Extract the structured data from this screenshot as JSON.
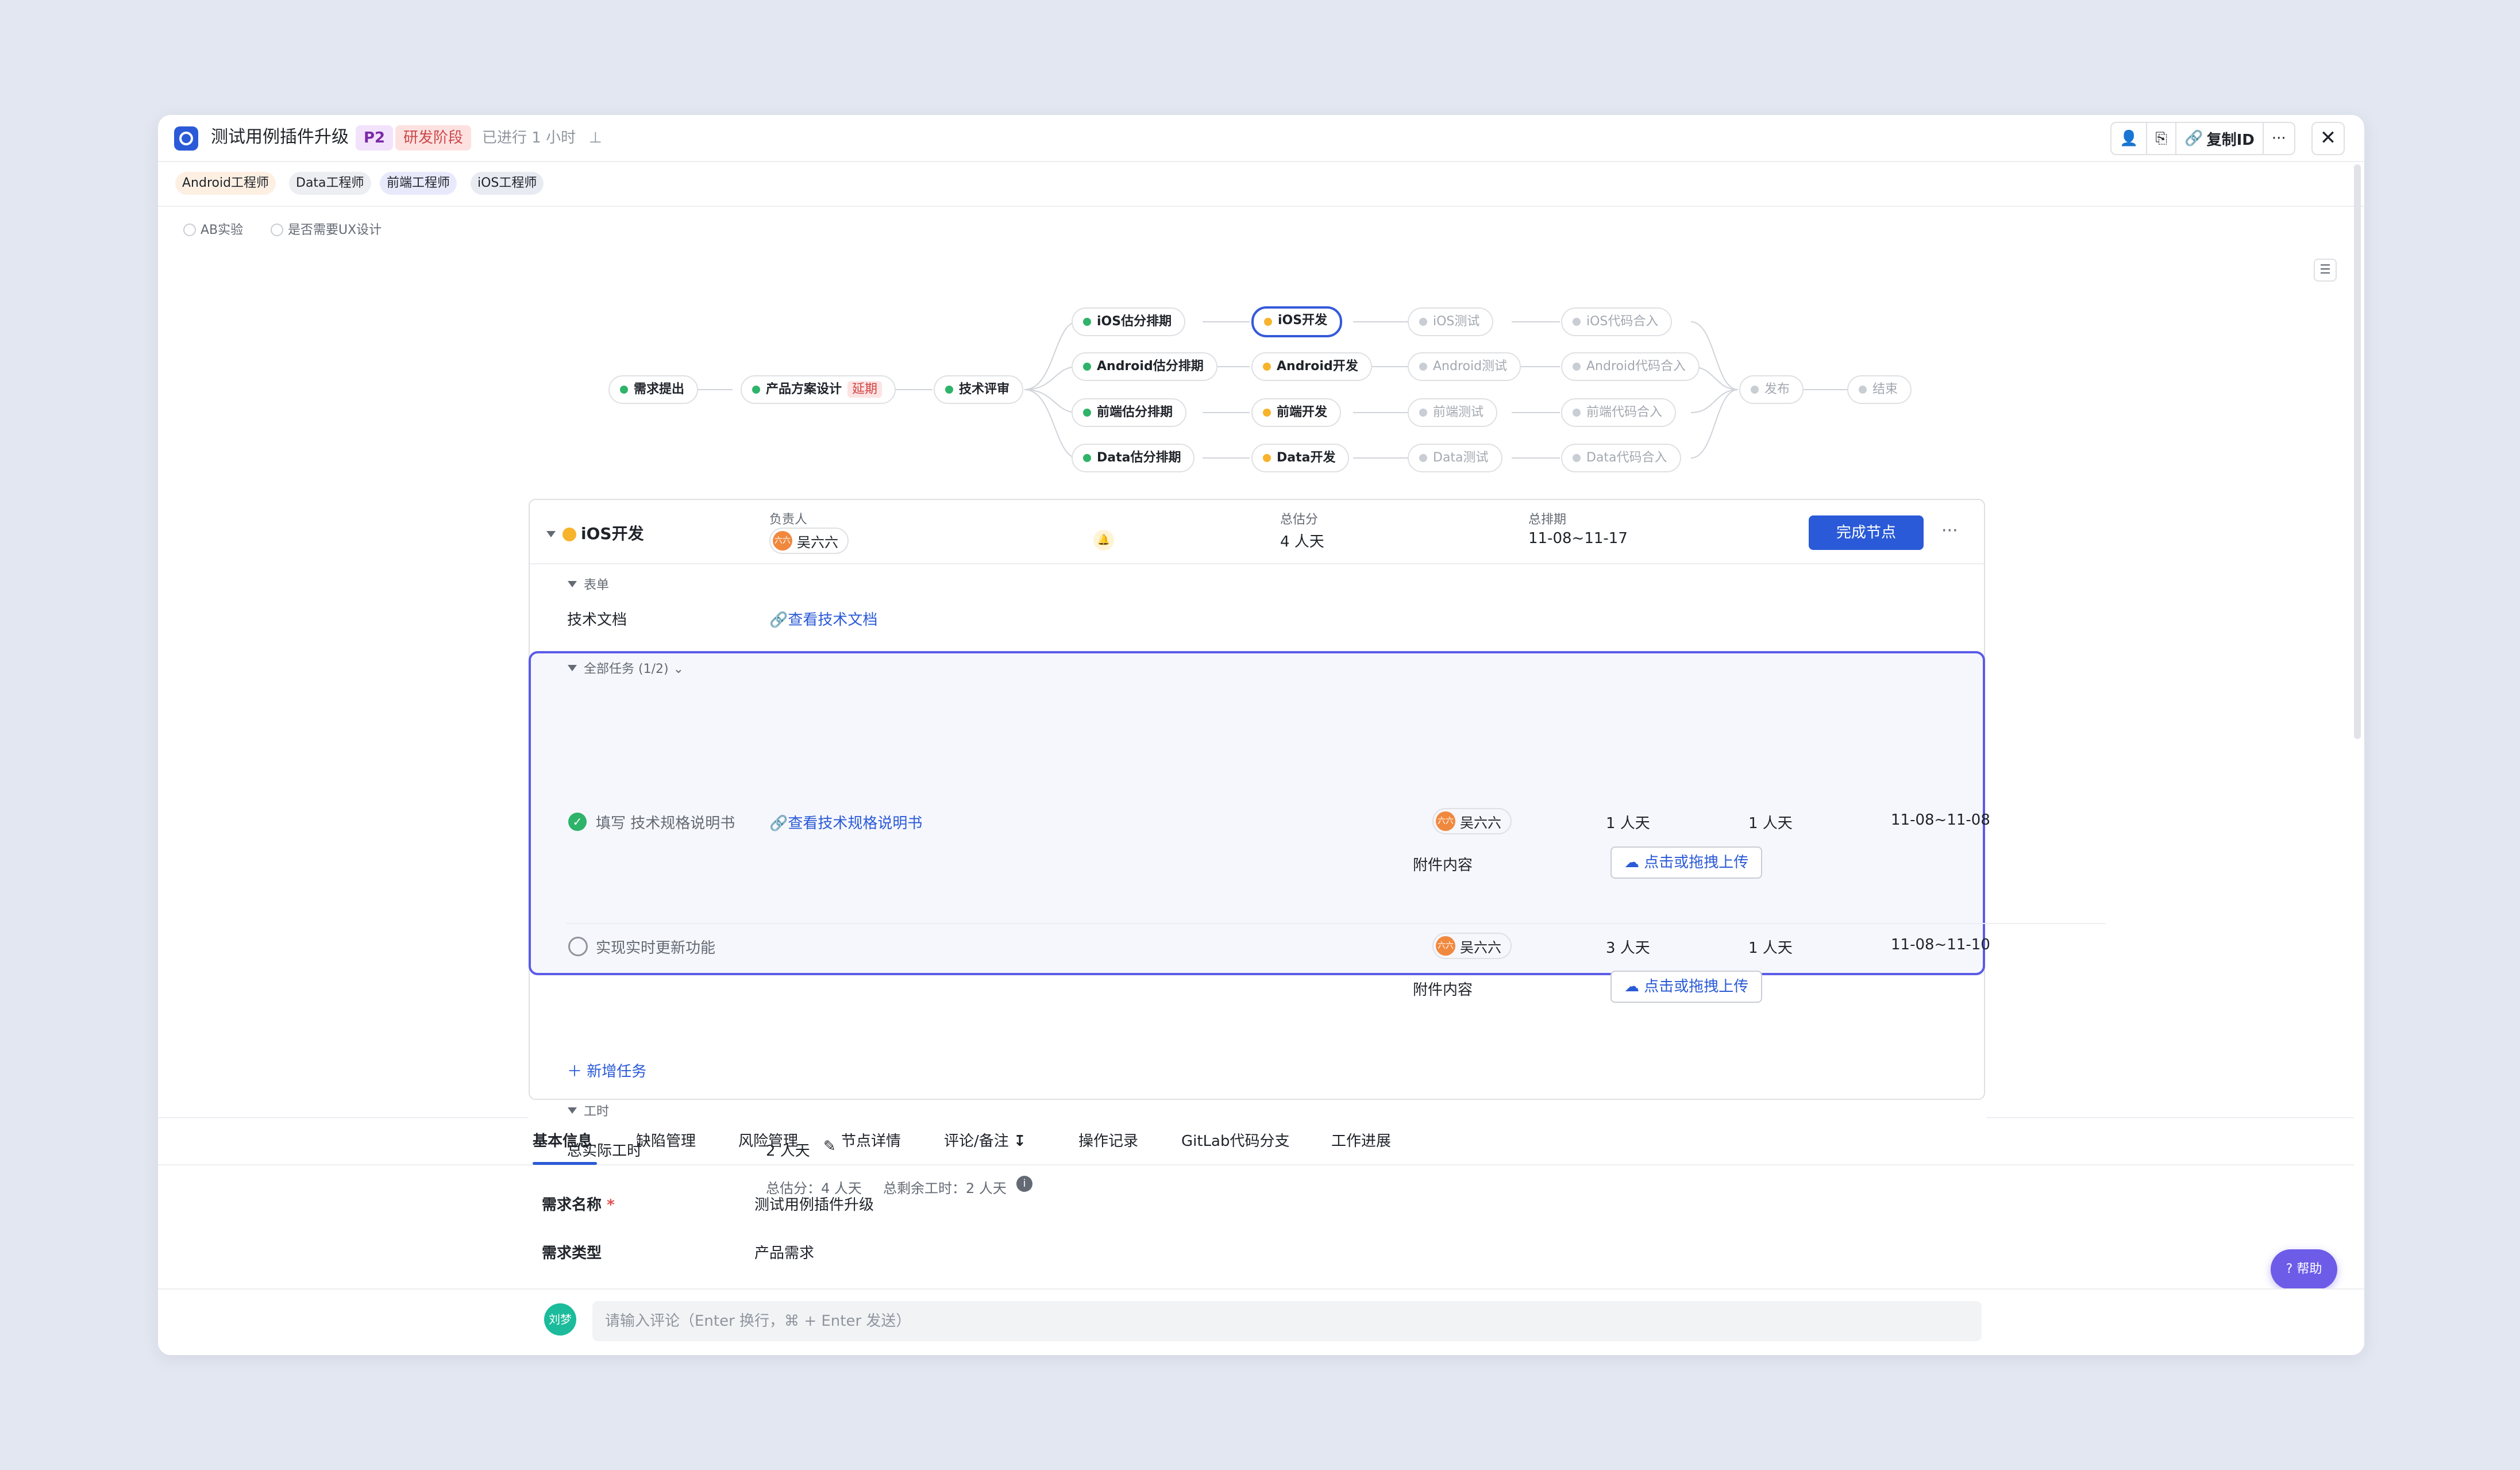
{
  "header": {
    "title": "测试用例插件升级",
    "priority": "P2",
    "stage": "研发阶段",
    "elapsed": "已进行 1 小时",
    "pin_icon": "pin-icon",
    "copy_id": "复制ID",
    "more": "···",
    "close": "✕"
  },
  "roles": [
    "Android工程师",
    "Data工程师",
    "前端工程师",
    "iOS工程师"
  ],
  "checkboxes": [
    "AB实验",
    "是否需要UX设计"
  ],
  "flow": {
    "start": [
      "需求提出",
      "产品方案设计",
      "技术评审"
    ],
    "late_label": "延期",
    "estimate": [
      "iOS估分排期",
      "Android估分排期",
      "前端估分排期",
      "Data估分排期"
    ],
    "dev": [
      "iOS开发",
      "Android开发",
      "前端开发",
      "Data开发"
    ],
    "test": [
      "iOS测试",
      "Android测试",
      "前端测试",
      "Data测试"
    ],
    "merge": [
      "iOS代码合入",
      "Android代码合入",
      "前端代码合入",
      "Data代码合入"
    ],
    "end": [
      "发布",
      "结束"
    ],
    "colors": {
      "done": "#2fb36a",
      "in_progress": "#f7b32b",
      "pending": "#c9cdd4",
      "active_border": "#3559d9"
    }
  },
  "node_detail": {
    "name": "iOS开发",
    "owner_label": "负责人",
    "owner": "吴六六",
    "owner_avatar": "六六",
    "estimate_label": "总估分",
    "estimate": "4 人天",
    "schedule_label": "总排期",
    "schedule": "11-08~11-17",
    "complete_btn": "完成节点",
    "more": "···",
    "form_section": "表单",
    "tech_doc_label": "技术文档",
    "tech_doc_link": "查看技术文档",
    "tasks_section": "全部任务 (1/2)",
    "tasks": [
      {
        "title": "填写 技术规格说明书",
        "link": "查看技术规格说明书",
        "owner": "吴六六",
        "estimate": "1 人天",
        "actual": "1 人天",
        "range": "11-08~11-08",
        "attach_label": "附件内容",
        "upload": "点击或拖拽上传",
        "done": true
      },
      {
        "title": "实现实时更新功能",
        "link": "",
        "owner": "吴六六",
        "estimate": "3 人天",
        "actual": "1 人天",
        "range": "11-08~11-10",
        "attach_label": "附件内容",
        "upload": "点击或拖拽上传",
        "done": false
      }
    ],
    "add_task": "新增任务",
    "hours_section": "工时",
    "actual_hours_label": "总实际工时",
    "actual_hours": "2 人天",
    "summary_estimate": "总估分：4 人天",
    "summary_remaining": "总剩余工时：2 人天"
  },
  "tabs": [
    "基本信息",
    "缺陷管理",
    "风险管理",
    "节点详情",
    "评论/备注",
    "操作记录",
    "GitLab代码分支",
    "工作进展"
  ],
  "basic_info": [
    {
      "label": "需求名称",
      "required": "*",
      "value": "测试用例插件升级"
    },
    {
      "label": "需求类型",
      "required": "",
      "value": "产品需求"
    }
  ],
  "help": "帮助",
  "comment": {
    "avatar": "刘梦",
    "placeholder": "请输入评论（Enter 换行，⌘ + Enter 发送）"
  }
}
